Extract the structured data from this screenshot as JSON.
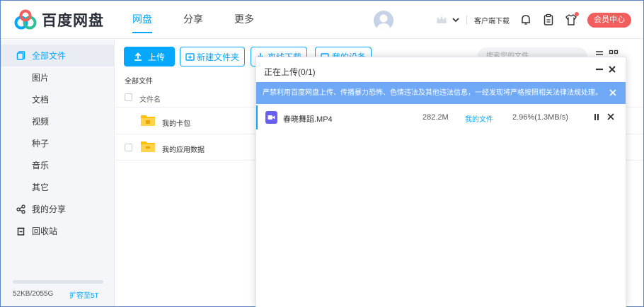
{
  "app": {
    "logo_text": "百度网盘",
    "brand_colors": [
      "#06a7ff",
      "#2fbf9a",
      "#f25d5d"
    ]
  },
  "header": {
    "nav": [
      {
        "label": "网盘",
        "active": true
      },
      {
        "label": "分享",
        "active": false
      },
      {
        "label": "更多",
        "active": false
      }
    ],
    "client_download": "客户端下载",
    "vip_button": "会员中心",
    "icons": [
      "crown-icon",
      "chevron-down-icon",
      "bell-icon",
      "clipboard-icon",
      "shirt-icon"
    ]
  },
  "sidebar": {
    "items": [
      {
        "label": "全部文件",
        "icon": "file-icon",
        "active": true
      },
      {
        "label": "图片",
        "icon": null
      },
      {
        "label": "文档",
        "icon": null
      },
      {
        "label": "视频",
        "icon": null
      },
      {
        "label": "种子",
        "icon": null
      },
      {
        "label": "音乐",
        "icon": null
      },
      {
        "label": "其它",
        "icon": null
      },
      {
        "label": "我的分享",
        "icon": "share-icon"
      },
      {
        "label": "回收站",
        "icon": "trash-icon"
      }
    ],
    "quota": {
      "used_text": "52KB/2055G",
      "expand_link": "扩容至5T",
      "used_fraction": 0.0
    }
  },
  "toolbar": {
    "upload": "上传",
    "new_folder": "新建文件夹",
    "offline_download": "离线下载",
    "my_devices": "我的设备",
    "search_placeholder": "搜索您的文件"
  },
  "filelist": {
    "breadcrumb": "全部文件",
    "column_name": "文件名",
    "rows": [
      {
        "name": "我的卡包"
      },
      {
        "name": "我的应用数据"
      }
    ]
  },
  "upload_panel": {
    "title": "正在上传(0/1)",
    "warning": "严禁利用百度网盘上传、传播暴力恐怖、色情违法及其他违法信息，一经发现将严格按照相关法律法规处理。",
    "task": {
      "name": "春晓舞蹈.MP4",
      "size": "282.2M",
      "location": "我的文件",
      "progress": "2.96%(1.3MB/s)"
    }
  }
}
